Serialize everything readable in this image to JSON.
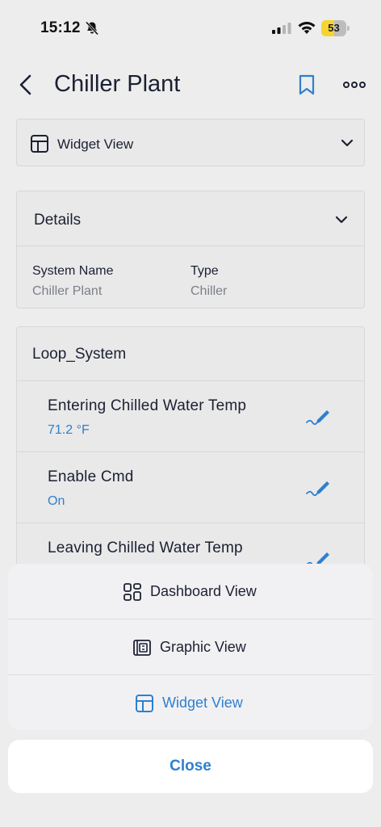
{
  "status_bar": {
    "time": "15:12",
    "battery": "53",
    "battery_level": 0.53
  },
  "header": {
    "title": "Chiller Plant"
  },
  "view_selector": {
    "label": "Widget View"
  },
  "details": {
    "title": "Details",
    "fields": [
      {
        "label": "System Name",
        "value": "Chiller Plant"
      },
      {
        "label": "Type",
        "value": "Chiller"
      }
    ]
  },
  "loop_system": {
    "title": "Loop_System",
    "points": [
      {
        "name": "Entering Chilled Water Temp",
        "value": "71.2 °F"
      },
      {
        "name": "Enable Cmd",
        "value": "On"
      },
      {
        "name": "Leaving Chilled Water Temp",
        "value": ""
      }
    ]
  },
  "action_sheet": {
    "items": [
      {
        "label": "Dashboard View",
        "icon": "dashboard-icon"
      },
      {
        "label": "Graphic View",
        "icon": "graphic-icon"
      },
      {
        "label": "Widget View",
        "icon": "widget-icon"
      }
    ],
    "close_label": "Close"
  },
  "colors": {
    "accent": "#2f7fcf",
    "background": "#ededed",
    "battery": "#f4d530"
  }
}
